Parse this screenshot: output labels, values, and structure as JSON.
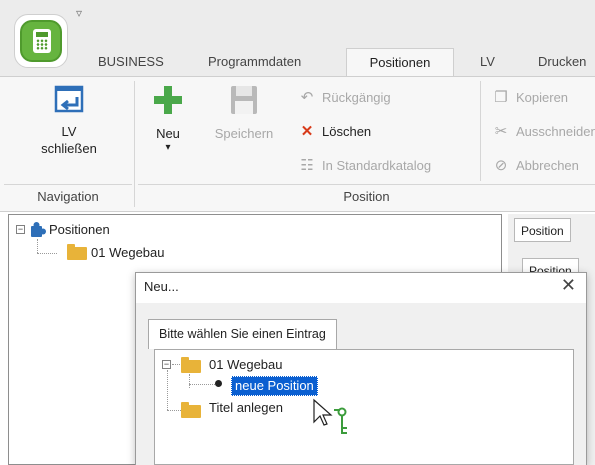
{
  "app": {
    "quick_access": "▿"
  },
  "tabs": [
    {
      "label": "BUSINESS"
    },
    {
      "label": "Programmdaten"
    },
    {
      "label": "Positionen"
    },
    {
      "label": "LV"
    },
    {
      "label": "Drucken"
    }
  ],
  "ribbon": {
    "navigation": {
      "lv_close_line1": "LV",
      "lv_close_line2": "schließen",
      "group_label": "Navigation"
    },
    "position": {
      "new_label": "Neu",
      "new_arrow": "▾",
      "save_label": "Speichern",
      "undo_label": "Rückgängig",
      "delete_label": "Löschen",
      "standard_catalog_label": "In Standardkatalog",
      "copy_label": "Kopieren",
      "cut_label": "Ausschneiden",
      "cancel_label": "Abbrechen",
      "group_label": "Position"
    }
  },
  "tree": {
    "root_label": "Positionen",
    "child_label": "01 Wegebau"
  },
  "right_panel": {
    "tab1": "Position",
    "tab2": "Position"
  },
  "dialog": {
    "title": "Neu...",
    "close": "✕",
    "tab_label": "Bitte wählen Sie einen Eintrag",
    "tree": {
      "folder_label": "01 Wegebau",
      "new_position_label": "neue Position",
      "title_create_label": "Titel anlegen"
    }
  },
  "colors": {
    "accent_green": "#66b43f",
    "delete_red": "#d83b1a",
    "selection_blue": "#0a5fd1",
    "folder_yellow": "#e8b339"
  }
}
